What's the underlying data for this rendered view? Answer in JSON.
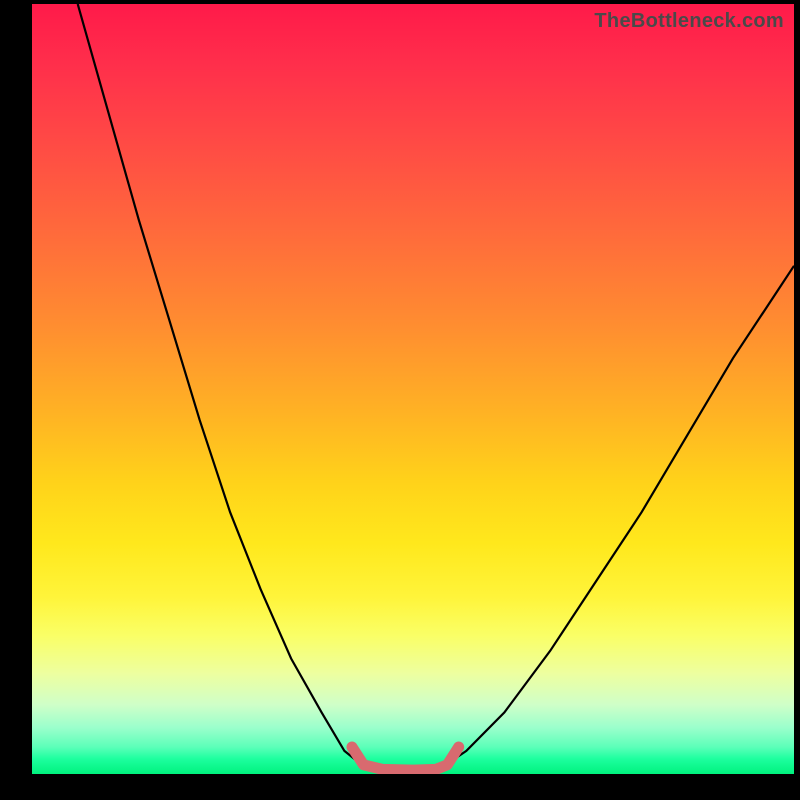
{
  "watermark": "TheBottleneck.com",
  "colors": {
    "curve": "#000000",
    "highlight": "#d86a6f",
    "background": "#000000"
  },
  "chart_data": {
    "type": "line",
    "title": "",
    "xlabel": "",
    "ylabel": "",
    "xlim": [
      0,
      100
    ],
    "ylim": [
      0,
      100
    ],
    "grid": false,
    "annotations": [],
    "series": [
      {
        "name": "left-branch",
        "x": [
          6,
          10,
          14,
          18,
          22,
          26,
          30,
          34,
          38,
          41,
          43.5
        ],
        "y": [
          100,
          86,
          72,
          59,
          46,
          34,
          24,
          15,
          8,
          3,
          1
        ]
      },
      {
        "name": "right-branch",
        "x": [
          54,
          57,
          62,
          68,
          74,
          80,
          86,
          92,
          98,
          100
        ],
        "y": [
          1,
          3,
          8,
          16,
          25,
          34,
          44,
          54,
          63,
          66
        ]
      },
      {
        "name": "floor-highlight",
        "x": [
          42,
          43.5,
          46,
          50,
          53,
          54.5,
          56
        ],
        "y": [
          3.5,
          1.2,
          0.6,
          0.5,
          0.6,
          1.2,
          3.5
        ]
      }
    ]
  }
}
